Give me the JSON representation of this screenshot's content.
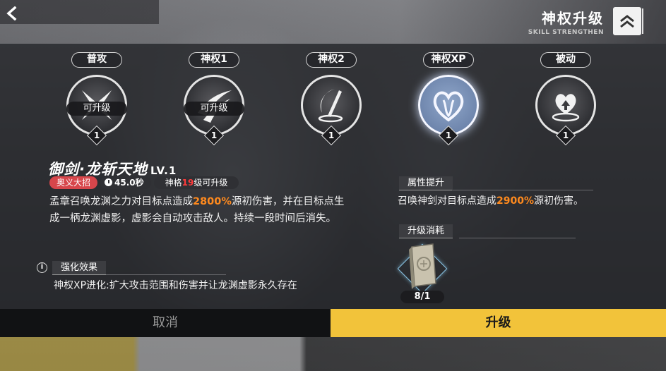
{
  "header": {
    "title": "神权升级",
    "subtitle": "SKILL STRENGTHEN",
    "back_icon": "chevron-left-icon",
    "collapse_icon": "double-chevron-up-icon"
  },
  "skills": [
    {
      "label": "普攻",
      "icon": "cross-blades-icon",
      "upgrade_badge": "可升级",
      "level": "1",
      "selected": false
    },
    {
      "label": "神权1",
      "icon": "slash-icon",
      "upgrade_badge": "可升级",
      "level": "1",
      "selected": false
    },
    {
      "label": "神权2",
      "icon": "sword-moon-icon",
      "upgrade_badge": "",
      "level": "1",
      "selected": false
    },
    {
      "label": "神权XP",
      "icon": "spirit-heart-icon",
      "upgrade_badge": "",
      "level": "1",
      "selected": true
    },
    {
      "label": "被动",
      "icon": "heart-arrow-icon",
      "upgrade_badge": "",
      "level": "1",
      "selected": false
    }
  ],
  "detail": {
    "name": "御剑·龙斩天地",
    "level": "LV.1",
    "tag_type": "奥义大招",
    "cooldown": "45.0秒",
    "req_prefix": "神格",
    "req_level": "19",
    "req_suffix": "级可升级",
    "desc_part1": "孟章召唤龙渊之力对目标点造成",
    "desc_value": "2800%",
    "desc_part2": "源初伤害，并在目标点生成一柄龙渊虚影，虚影会自动攻击敌人。持续一段时间后消失。",
    "enhance_title": "强化效果",
    "enhance_text": "神权XP进化:扩大攻击范围和伤害并让龙渊虚影永久存在"
  },
  "attribute": {
    "title": "属性提升",
    "part1": "召唤神剑对目标点造成",
    "value": "2900%",
    "part2": "源初伤害。"
  },
  "cost": {
    "title": "升级消耗",
    "item_icon": "skill-book-icon",
    "count": "8/1"
  },
  "buttons": {
    "cancel": "取消",
    "upgrade": "升级"
  },
  "colors": {
    "accent_yellow": "#f2c33a",
    "highlight_orange": "#ff8a1e",
    "tag_red": "#d7464b",
    "req_red": "#ff3b3b"
  }
}
